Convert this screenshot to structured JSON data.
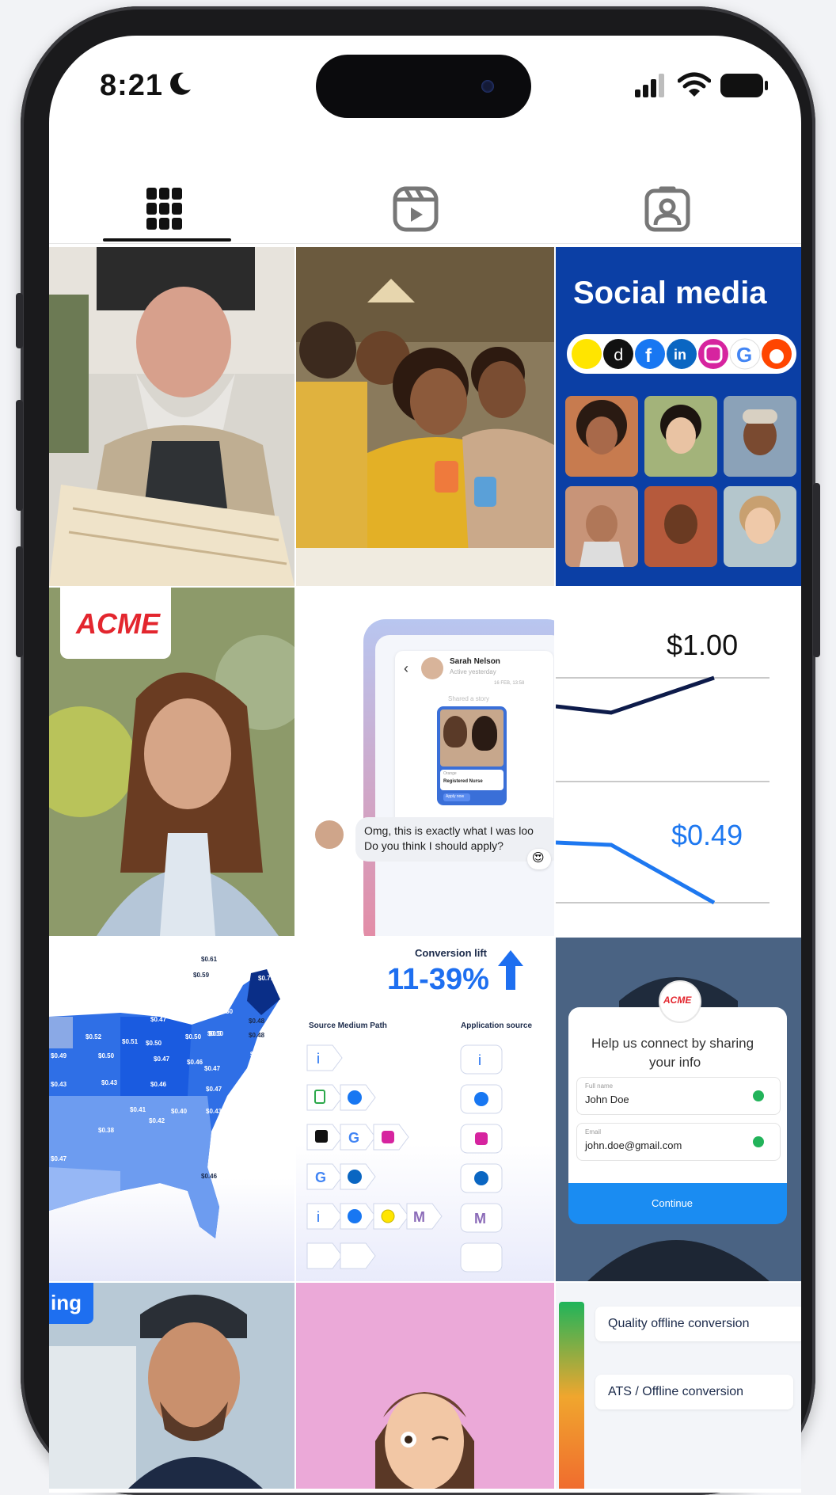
{
  "status_bar": {
    "time": "8:21"
  },
  "tabs": [
    {
      "name": "grid",
      "icon": "grid-icon"
    },
    {
      "name": "reels",
      "icon": "reels-icon"
    },
    {
      "name": "tagged",
      "icon": "tagged-icon"
    }
  ],
  "posts": {
    "social_media": {
      "title": "Social media",
      "icons": [
        "snapchat-icon",
        "tiktok-icon",
        "facebook-icon",
        "linkedin-icon",
        "instagram-icon",
        "google-icon",
        "reddit-icon"
      ]
    },
    "acme_nurse": {
      "logo": "ACME"
    },
    "chat": {
      "name": "Sarah Nelson",
      "status": "Active yesterday",
      "date": "16 FEB, 13:58",
      "shared": "Shared a story",
      "card_tag": "Orange",
      "card_title": "Registered Nurse",
      "card_button": "Apply now",
      "msg_line1": "Omg, this is exactly what I was loo",
      "msg_line2": "Do you think I should apply?",
      "reaction": "😍"
    },
    "price_chart": {
      "top_value": "$1.00",
      "bottom_value": "$0.49"
    },
    "map": {
      "labels": [
        "$0.61",
        "$0.59",
        "$0.71",
        "$0.59",
        "$0.57",
        "$0.47",
        "$0.50",
        "$0.52",
        "$0.51",
        "$0.50",
        "$0.50",
        "$0.50",
        "$0.48",
        "$0.48",
        "$0.49",
        "$0.50",
        "$0.47",
        "$0.46",
        "$0.47",
        "$0.47",
        "$0.43",
        "$0.43",
        "$0.46",
        "$0.47",
        "$0.41",
        "$0.40",
        "$0.42",
        "$0.43",
        "$0.38",
        "$0.47",
        "$0.46",
        "$0.5"
      ]
    },
    "conversion": {
      "title": "Conversion lift",
      "value": "11-39%",
      "col1": "Source Medium Path",
      "col2": "Application source"
    },
    "form": {
      "logo": "ACME",
      "heading_line1": "Help us connect by sharing",
      "heading_line2": "your info",
      "name_label": "Full name",
      "name_value": "John Doe",
      "email_label": "Email",
      "email_value": "john.doe@gmail.com",
      "button": "Continue"
    },
    "driver": {
      "banner": "ing"
    },
    "quality": {
      "chip1": "Quality offline conversion",
      "chip2": "ATS / Offline conversion"
    }
  }
}
